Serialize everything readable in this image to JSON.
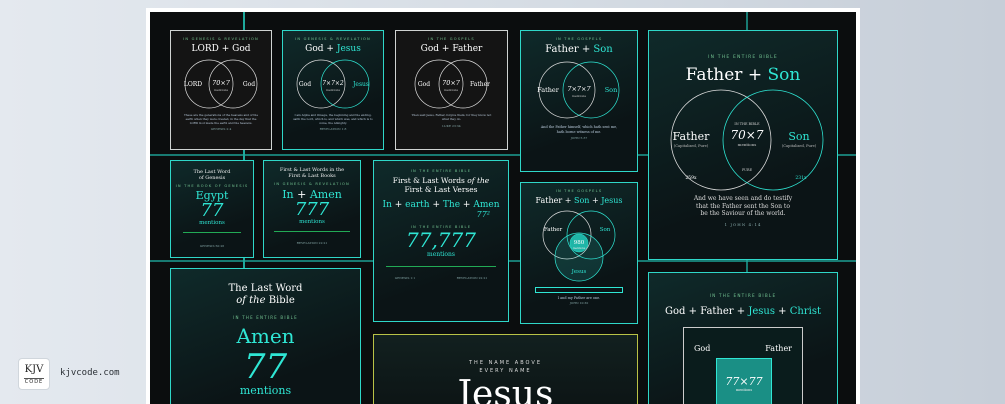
{
  "brand": {
    "logo_main": "KJV",
    "logo_sub": "CODE",
    "site": "kjvcode.com"
  },
  "colors": {
    "accent": "#2fe6d4",
    "board": "#0b0d0e"
  },
  "cards": {
    "c1": {
      "caption": "IN GENESIS & REVELATION",
      "title_a": "LORD",
      "plus": "+",
      "title_b": "God",
      "left": "LORD",
      "right": "God",
      "center": "70×7",
      "center_sub": "mentions",
      "body": "These are the generations of the heavens and of the earth when they were created, in the day that the LORD God made the earth and the heavens.",
      "ref": "GENESIS 2:4"
    },
    "c2": {
      "caption": "IN GENESIS & REVELATION",
      "title_a": "God",
      "plus": "+",
      "title_b": "Jesus",
      "left": "God",
      "right": "Jesus",
      "center": "7×7×2",
      "center_sub": "mentions",
      "body": "I am Alpha and Omega, the beginning and the ending, saith the Lord, which is, and which was, and which is to come, the Almighty.",
      "ref": "REVELATION 1:8"
    },
    "c3": {
      "caption": "IN THE GOSPELS",
      "title_a": "God",
      "plus": "+",
      "title_b": "Father",
      "left": "God",
      "right": "Father",
      "center": "70×7",
      "center_sub": "mentions",
      "body": "Then said Jesus, Father, forgive them; for they know not what they do.",
      "ref": "LUKE 23:34"
    },
    "c4": {
      "caption": "IN THE GOSPELS",
      "title_a": "Father",
      "plus": "+",
      "title_b": "Son",
      "left": "Father",
      "right": "Son",
      "center": "7×7×7",
      "center_sub": "mentions",
      "body": "And the Father himself, which hath sent me, hath borne witness of me.",
      "ref": "JOHN 5:37"
    },
    "c5": {
      "caption": "IN THE ENTIRE BIBLE",
      "title_a": "Father",
      "plus": "+",
      "title_b": "Son",
      "left": "Father",
      "left_sub": "(Capitalized, Pure)",
      "right": "Son",
      "right_sub": "(Capitalized, Pure)",
      "in_label": "IN THE BIBLE",
      "center": "70×7",
      "center_sub": "mentions",
      "pure": "PURE",
      "left_count": "259x",
      "right_count": "231x",
      "body": "And we have seen and do testify that the Father sent the Son to be the Saviour of the world.",
      "ref": "1 JOHN 4:14"
    },
    "c6": {
      "title_a": "The Last Word",
      "title_b": "of Genesis",
      "caption": "IN THE BOOK OF GENESIS",
      "word": "Egypt",
      "number": "77",
      "unit": "mentions",
      "ref": "GENESIS 50:26"
    },
    "c7": {
      "title_a": "First & Last Words in the",
      "title_b": "First & Last Books",
      "caption": "IN GENESIS & REVELATION",
      "word_a": "In",
      "plus": "+",
      "word_b": "Amen",
      "number": "777",
      "unit": "mentions",
      "ref": "REVELATION 22:21"
    },
    "c8": {
      "caption": "IN THE ENTIRE BIBLE",
      "title_a": "First & Last Words",
      "title_b": "of the",
      "title_c": "First & Last Verses",
      "w1": "In",
      "w2": "earth",
      "w3": "The",
      "w4": "Amen",
      "plus": "+",
      "power": "77²",
      "caption2": "IN THE ENTIRE BIBLE",
      "number": "77,777",
      "unit": "mentions",
      "ref_a": "GENESIS 1:1",
      "ref_b": "REVELATION 22:21"
    },
    "c9": {
      "caption": "IN THE GOSPELS",
      "title_a": "Father",
      "title_b": "Son",
      "title_c": "Jesus",
      "plus": "+",
      "left": "Father",
      "right": "Son",
      "bottom": "Jesus",
      "center": "980",
      "center_sub": "mentions",
      "body": "I and my Father are one.",
      "ref": "JOHN 10:30"
    },
    "c10": {
      "title_a": "The Last Word",
      "title_b": "of the",
      "title_c": "Bible",
      "caption": "IN THE ENTIRE BIBLE",
      "word": "Amen",
      "number": "77",
      "unit": "mentions"
    },
    "c11": {
      "line1": "THE NAME ABOVE",
      "line2": "EVERY NAME",
      "word": "Jesus"
    },
    "c12": {
      "caption": "IN THE ENTIRE BIBLE",
      "title_a": "God",
      "title_b": "Father",
      "title_c": "Jesus",
      "title_d": "Christ",
      "plus": "+",
      "left": "God",
      "right": "Father",
      "center": "77×77",
      "center_sub": "mentions"
    }
  }
}
